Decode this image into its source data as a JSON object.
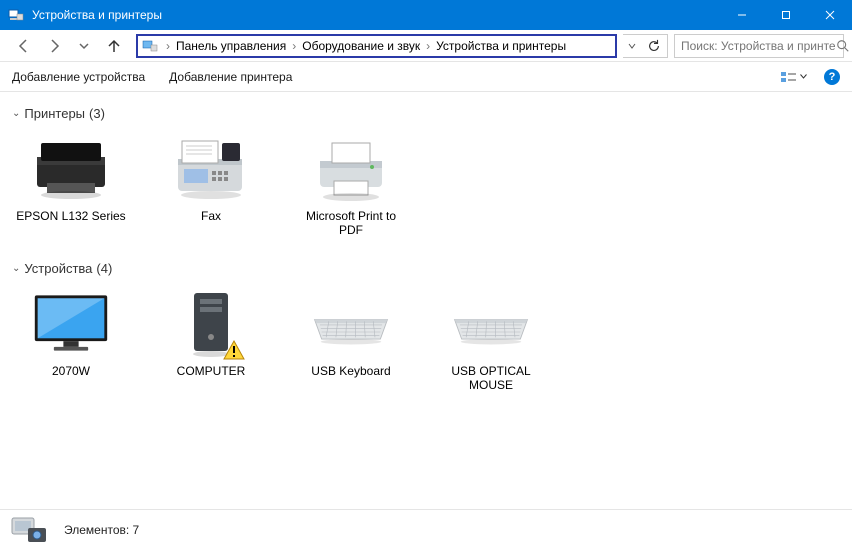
{
  "window": {
    "title": "Устройства и принтеры"
  },
  "nav": {
    "breadcrumb": [
      "Панель управления",
      "Оборудование и звук",
      "Устройства и принтеры"
    ]
  },
  "search": {
    "placeholder": "Поиск: Устройства и принте..."
  },
  "toolbar": {
    "add_device": "Добавление устройства",
    "add_printer": "Добавление принтера"
  },
  "sections": {
    "printers": {
      "title": "Принтеры",
      "count": "(3)"
    },
    "devices": {
      "title": "Устройства",
      "count": "(4)"
    }
  },
  "printers": [
    {
      "label": "EPSON L132 Series"
    },
    {
      "label": "Fax"
    },
    {
      "label": "Microsoft Print to PDF"
    }
  ],
  "devices": [
    {
      "label": "2070W"
    },
    {
      "label": "COMPUTER"
    },
    {
      "label": "USB Keyboard"
    },
    {
      "label": "USB OPTICAL MOUSE"
    }
  ],
  "status": {
    "label": "Элементов:",
    "count": "7"
  }
}
